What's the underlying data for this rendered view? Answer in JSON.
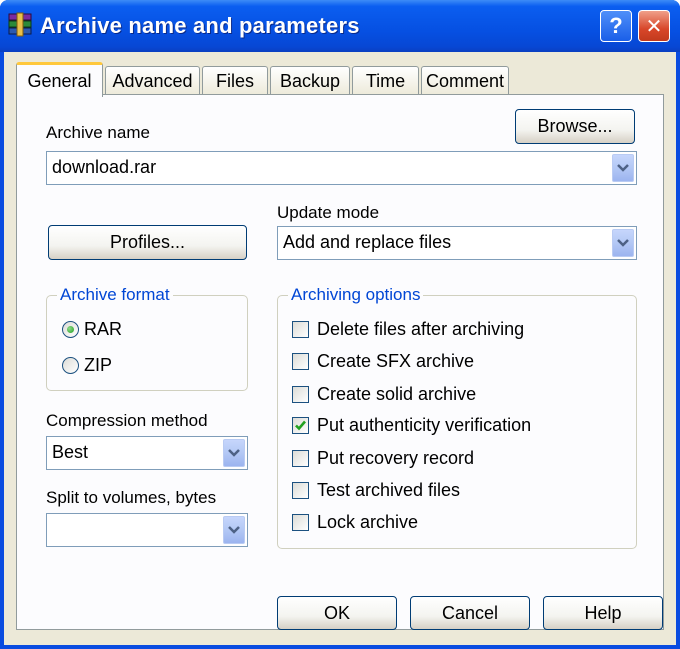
{
  "window": {
    "title": "Archive name and parameters",
    "help_glyph": "?",
    "close_glyph": "✕",
    "app_icon": "winrar-books-icon"
  },
  "tabs": [
    {
      "label": "General",
      "active": true
    },
    {
      "label": "Advanced",
      "active": false
    },
    {
      "label": "Files",
      "active": false
    },
    {
      "label": "Backup",
      "active": false
    },
    {
      "label": "Time",
      "active": false
    },
    {
      "label": "Comment",
      "active": false
    }
  ],
  "general": {
    "archive_name_label": "Archive name",
    "browse_label": "Browse...",
    "archive_name_value": "download.rar",
    "profiles_label": "Profiles...",
    "update_mode_label": "Update mode",
    "update_mode_value": "Add and replace files",
    "archive_format": {
      "title": "Archive format",
      "options": [
        {
          "label": "RAR",
          "selected": true
        },
        {
          "label": "ZIP",
          "selected": false
        }
      ]
    },
    "compression_method_label": "Compression method",
    "compression_method_value": "Best",
    "split_label": "Split to volumes, bytes",
    "split_value": "",
    "archiving_options": {
      "title": "Archiving options",
      "items": [
        {
          "label": "Delete files after archiving",
          "checked": false
        },
        {
          "label": "Create SFX archive",
          "checked": false
        },
        {
          "label": "Create solid archive",
          "checked": false
        },
        {
          "label": "Put authenticity verification",
          "checked": true
        },
        {
          "label": "Put recovery record",
          "checked": false
        },
        {
          "label": "Test archived files",
          "checked": false
        },
        {
          "label": "Lock archive",
          "checked": false
        }
      ]
    }
  },
  "footer": {
    "ok_label": "OK",
    "cancel_label": "Cancel",
    "help_label": "Help"
  },
  "colors": {
    "titlebar": "#0650e2",
    "dialog_bg": "#ece9d8",
    "group_title": "#0046d5",
    "check_mark": "#21a121",
    "active_tab_accent": "#ffc83c"
  }
}
